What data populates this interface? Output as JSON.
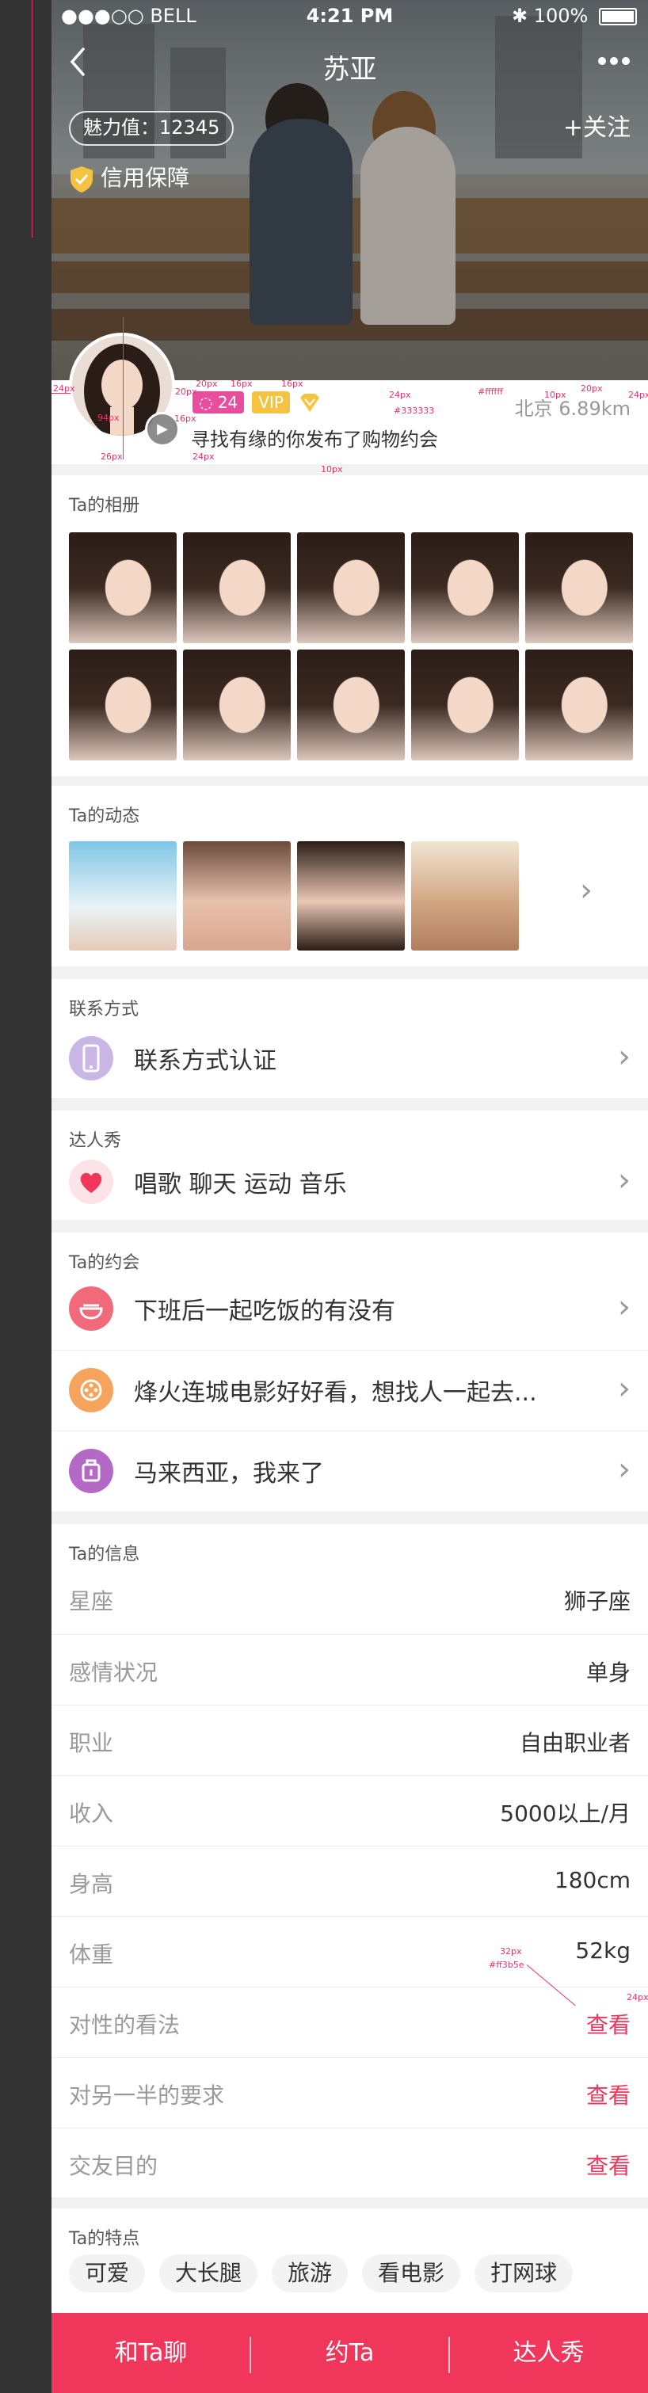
{
  "status_bar": {
    "carrier": "●●●○○ BELL",
    "time": "4:21 PM",
    "battery": "100%"
  },
  "nav": {
    "title": "苏亚",
    "back_icon": "chevron-left-icon",
    "more_icon": "more-dots-icon"
  },
  "hero": {
    "charm": "魅力值：12345",
    "follow": "+关注",
    "guarantee": "信用保障"
  },
  "profile": {
    "badge_count": "24",
    "badge_vip": "VIP",
    "distance": "北京 6.89km",
    "desc": "寻找有缘的你发布了购物约会"
  },
  "album": {
    "title": "Ta的相册"
  },
  "moments": {
    "title": "Ta的动态"
  },
  "contact": {
    "title": "联系方式",
    "item": "联系方式认证"
  },
  "talent": {
    "title": "达人秀",
    "tags": "唱歌  聊天  运动  音乐"
  },
  "dates": {
    "title": "Ta的约会",
    "items": [
      {
        "text": "下班后一起吃饭的有没有",
        "color": "#f06a7c"
      },
      {
        "text": "烽火连城电影好好看，想找人一起去...",
        "color": "#f5a35d"
      },
      {
        "text": "马来西亚，我来了",
        "color": "#b569c7"
      }
    ]
  },
  "info": {
    "title": "Ta的信息",
    "rows": [
      {
        "label": "星座",
        "value": "狮子座"
      },
      {
        "label": "感情状况",
        "value": "单身"
      },
      {
        "label": "职业",
        "value": "自由职业者"
      },
      {
        "label": "收入",
        "value": "5000以上/月"
      },
      {
        "label": "身高",
        "value": "180cm"
      },
      {
        "label": "体重",
        "value": "52kg"
      },
      {
        "label": "对性的看法",
        "value": "查看"
      },
      {
        "label": "对另一半的要求",
        "value": "查看"
      },
      {
        "label": "交友目的",
        "value": "查看"
      }
    ]
  },
  "features": {
    "title": "Ta的特点",
    "tags": [
      "可爱",
      "大长腿",
      "旅游",
      "看电影",
      "打网球"
    ]
  },
  "tabbar": {
    "chat": "和Ta聊",
    "date": "约Ta",
    "talent": "达人秀"
  },
  "annotations": {
    "a1": "24px",
    "a2": "94px",
    "a3": "26px",
    "a4": "20px",
    "a5": "16px",
    "a6": "16px",
    "a7": "24px",
    "a8": "24px",
    "a9": "10px",
    "a10": "#333333",
    "a11": "#ffffff",
    "a12": "10px",
    "a13": "20px",
    "a14": "24px",
    "a15": "32px",
    "a16": "#ff3b5e",
    "a17": "24px",
    "a18": "16px",
    "a19": "20px"
  },
  "colors": {
    "accent": "#f0365b",
    "badge_pink": "#e84e9d",
    "vip": "#f5c342"
  }
}
